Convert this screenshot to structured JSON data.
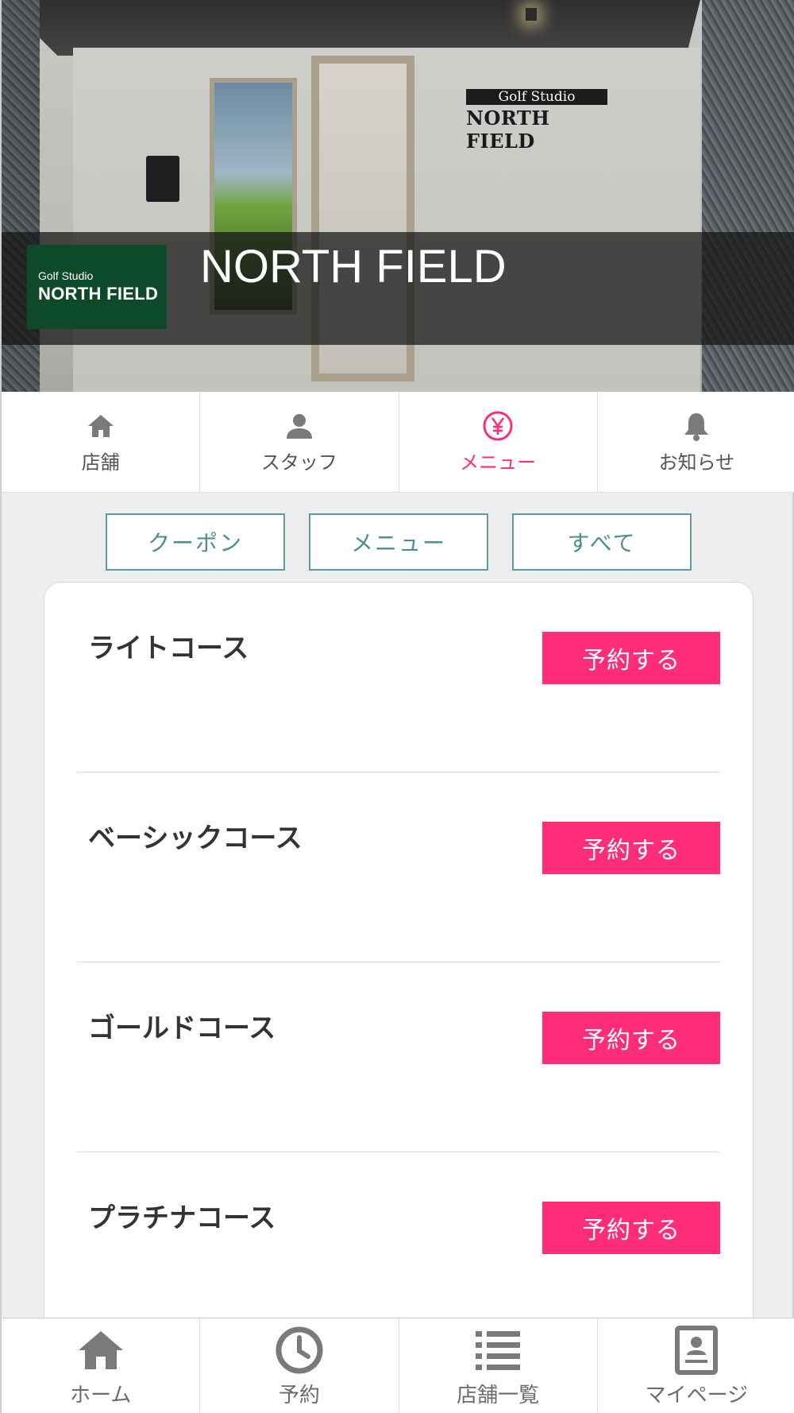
{
  "hero": {
    "wall_sign_small": "Golf Studio",
    "wall_sign_main": "NORTH FIELD",
    "logo_small": "Golf Studio",
    "logo_main": "NORTH FIELD",
    "shop_name": "NORTH FIELD"
  },
  "tabs": [
    {
      "label": "店舗",
      "icon": "home-icon",
      "active": false
    },
    {
      "label": "スタッフ",
      "icon": "person-icon",
      "active": false
    },
    {
      "label": "メニュー",
      "icon": "yen-icon",
      "active": true
    },
    {
      "label": "お知らせ",
      "icon": "bell-icon",
      "active": false
    }
  ],
  "filters": [
    {
      "label": "クーポン"
    },
    {
      "label": "メニュー"
    },
    {
      "label": "すべて"
    }
  ],
  "menu_items": [
    {
      "name": "ライトコース",
      "button": "予約する"
    },
    {
      "name": "ベーシックコース",
      "button": "予約する"
    },
    {
      "name": "ゴールドコース",
      "button": "予約する"
    },
    {
      "name": "プラチナコース",
      "button": "予約する"
    }
  ],
  "bottom_nav": [
    {
      "label": "ホーム",
      "icon": "home-icon"
    },
    {
      "label": "予約",
      "icon": "clock-icon"
    },
    {
      "label": "店舗一覧",
      "icon": "list-icon"
    },
    {
      "label": "マイページ",
      "icon": "profile-card-icon"
    }
  ],
  "colors": {
    "accent": "#ff2d78",
    "filter_border": "#5a9a9a",
    "logo_green": "#0d4a2a"
  }
}
